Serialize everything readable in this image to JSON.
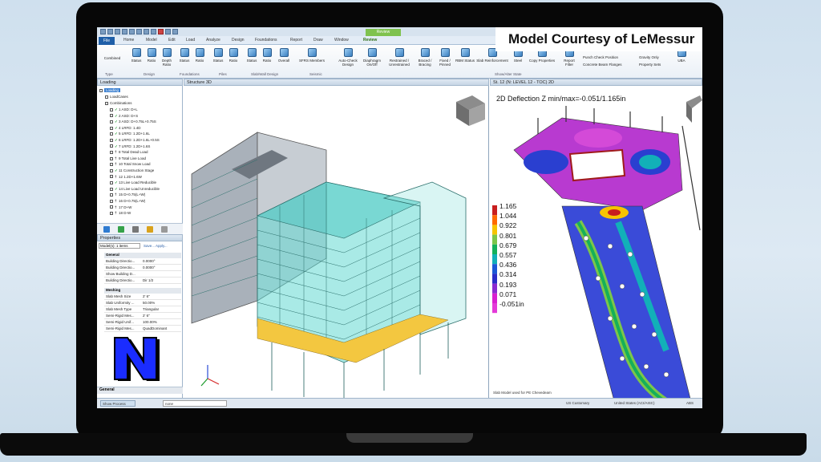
{
  "title_bar": {
    "context_tab": "Review"
  },
  "tabs": [
    "File",
    "Home",
    "Model",
    "Edit",
    "Load",
    "Analyze",
    "Design",
    "Foundations",
    "Report",
    "Draw",
    "Window",
    "Review"
  ],
  "ribbon": {
    "combined": "Combined",
    "buttons": [
      "Status",
      "Ratio",
      "Depth Ratio",
      "Status",
      "Ratio",
      "Status",
      "Ratio",
      "Status",
      "Ratio",
      "Overall",
      "SFRS Members",
      "Auto-Check Design",
      "Diaphragm On/Off",
      "Restrained / Unrestrained",
      "Braced / Bracing",
      "Fixed / Pinned",
      "RBM Status",
      "Slab Reinforcement",
      "Steel",
      "Copy Properties",
      "Report Filter",
      "Punch Check Position",
      "Concrete Beam Flanges",
      "Gravity Only",
      "Property Sets",
      "UBA"
    ],
    "groups": [
      "Type",
      "Design",
      "Foundations",
      "Piles",
      "Slab/Wall Design",
      "Seismic",
      "Show/Alter State"
    ]
  },
  "courtesy": "Model Courtesy of LeMessur",
  "loading": {
    "title": "Loading",
    "root": "Loading",
    "children": [
      "LoadCases",
      "Combinations"
    ],
    "combos": [
      {
        "label": "1 ASD: D+L",
        "mark": "ok"
      },
      {
        "label": "2 ASD: D+S",
        "mark": "ok"
      },
      {
        "label": "3 ASD: D+0.75L+0.75S",
        "mark": "ok"
      },
      {
        "label": "4 LRFD: 1.4D",
        "mark": "ok"
      },
      {
        "label": "5 LRFD: 1.2D+1.6L",
        "mark": "ok"
      },
      {
        "label": "6 LRFD: 1.2D+1.6L+0.5S",
        "mark": "ok"
      },
      {
        "label": "7 LRFD: 1.2D+1.6S",
        "mark": "ok"
      },
      {
        "label": "8 Total Dead Load",
        "mark": "pin"
      },
      {
        "label": "9 Total Live Load",
        "mark": "pin"
      },
      {
        "label": "10 Total Snow Load",
        "mark": "pin"
      },
      {
        "label": "11 Construction Stage",
        "mark": "ok"
      },
      {
        "label": "12 1.2D+1.6W",
        "mark": "pin"
      },
      {
        "label": "13 Live Load Reducible",
        "mark": "ok"
      },
      {
        "label": "14 Live Load Unreducible",
        "mark": "ok"
      },
      {
        "label": "15 D+0.75(L+W)",
        "mark": "pin"
      },
      {
        "label": "16 D+0.75(L+W)",
        "mark": "pin"
      },
      {
        "label": "17 D+W",
        "mark": "pin"
      },
      {
        "label": "18 D-W",
        "mark": "pin"
      }
    ]
  },
  "properties": {
    "title": "Properties",
    "selector": "Model(s): 1 items",
    "links": "Save... Apply...",
    "groups": [
      "General",
      "Meshing"
    ],
    "rows_general": [
      {
        "k": "Building Directio...",
        "v": "0.0000°"
      },
      {
        "k": "Building Directio...",
        "v": "0.0000°"
      },
      {
        "k": "Show Building D...",
        "v": ""
      },
      {
        "k": "Building Directio...",
        "v": "Dir 1/2"
      }
    ],
    "rows_meshing": [
      {
        "k": "Slab Mesh Size",
        "v": "2' 6\""
      },
      {
        "k": "Slab Uniformity ...",
        "v": "50.00%"
      },
      {
        "k": "Slab Mesh Type",
        "v": "Triangular"
      },
      {
        "k": "Semi-Rigid Mes...",
        "v": "2' 6\""
      },
      {
        "k": "Semi-Rigid Unif...",
        "v": "100.00%"
      },
      {
        "k": "Semi-Rigid Mes...",
        "v": "QuadDominant"
      }
    ],
    "footer": "General"
  },
  "view3d": {
    "tab": "Structure 3D"
  },
  "view2d": {
    "tab": "St. 12 (N: LEVEL 12 - TOC) 2D",
    "title": "2D Deflection Z min/max=-0.051/1.165in",
    "legend": [
      "1.165",
      "1.044",
      "0.922",
      "0.801",
      "0.679",
      "0.557",
      "0.436",
      "0.314",
      "0.193",
      "0.071",
      "-0.051in"
    ],
    "legend_colors": [
      "#c81e1e",
      "#ff6a00",
      "#f7c400",
      "#7cc64a",
      "#14b05a",
      "#12b0b8",
      "#1b58d6",
      "#2a2cc8",
      "#8a2ad0",
      "#d81fd0",
      "#e43ad8"
    ],
    "footer": "Slab Model used for PE Chevedeam"
  },
  "status": {
    "show_process": "Show Process",
    "field": "none",
    "units": "US Customary",
    "code": "United States (ACI/AISC)",
    "misc": "ABS"
  },
  "logo_letter": "N"
}
